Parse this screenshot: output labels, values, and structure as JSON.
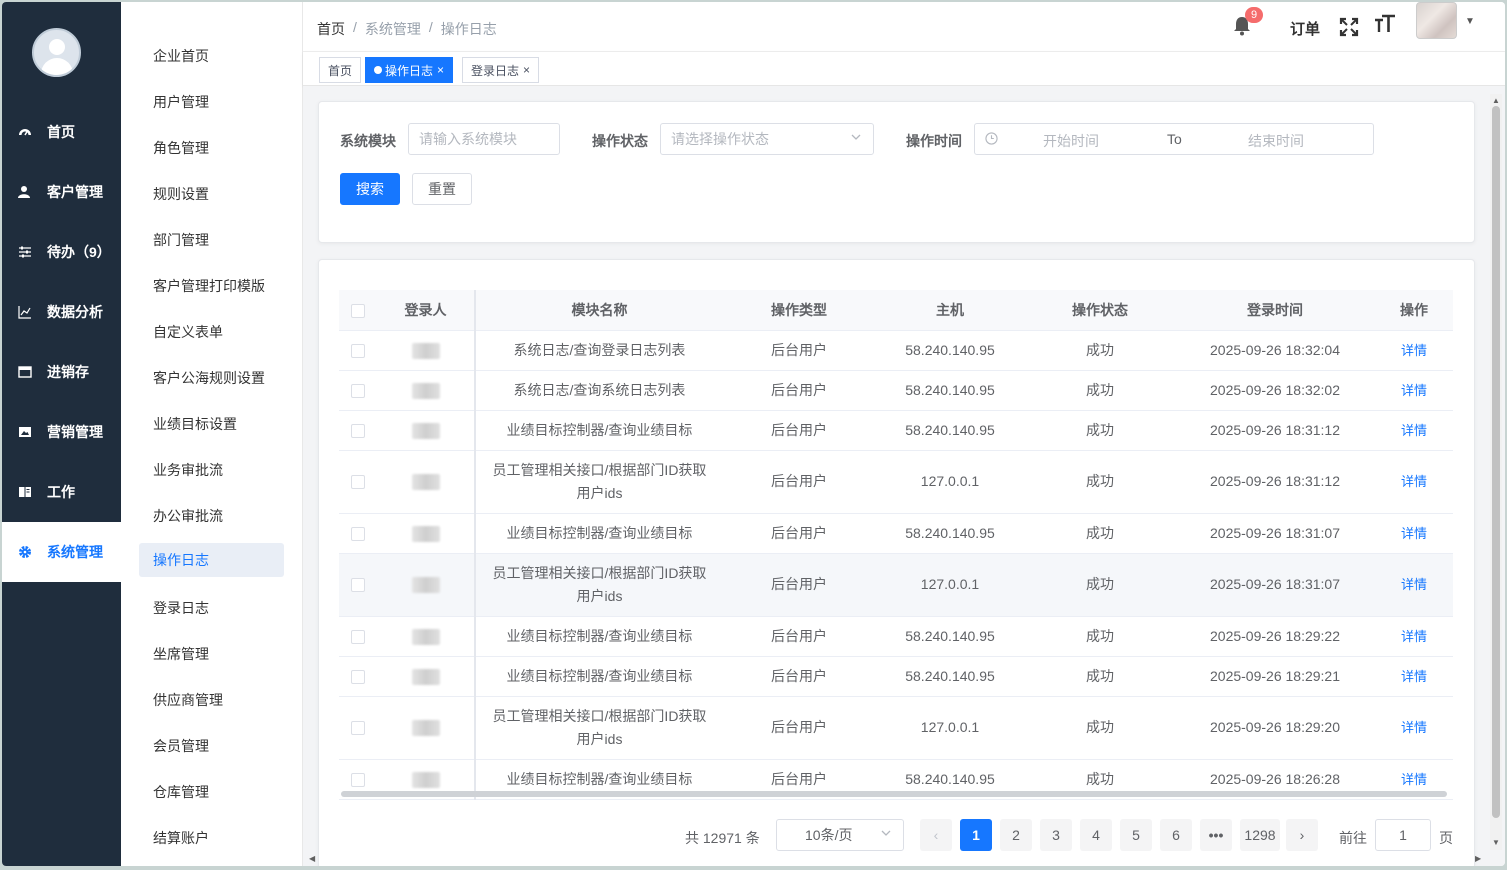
{
  "sidebar": {
    "items": [
      {
        "label": "首页",
        "icon": "dashboard-icon"
      },
      {
        "label": "客户管理",
        "icon": "user-icon"
      },
      {
        "label": "待办（9）",
        "icon": "sliders-icon"
      },
      {
        "label": "数据分析",
        "icon": "line-chart-icon"
      },
      {
        "label": "进销存",
        "icon": "window-icon"
      },
      {
        "label": "营销管理",
        "icon": "image-icon"
      },
      {
        "label": "工作",
        "icon": "book-icon"
      },
      {
        "label": "系统管理",
        "icon": "gear-icon"
      }
    ]
  },
  "submenu": {
    "items": [
      "企业首页",
      "用户管理",
      "角色管理",
      "规则设置",
      "部门管理",
      "客户管理打印模版",
      "自定义表单",
      "客户公海规则设置",
      "业绩目标设置",
      "业务审批流",
      "办公审批流",
      "操作日志",
      "登录日志",
      "坐席管理",
      "供应商管理",
      "会员管理",
      "仓库管理",
      "结算账户"
    ]
  },
  "header": {
    "breadcrumb": [
      "首页",
      "系统管理",
      "操作日志"
    ],
    "breadcrumb_sep": "/",
    "notification_count": "9",
    "order_label": "订单",
    "font_icon": "тT"
  },
  "tabs": [
    {
      "label": "首页"
    },
    {
      "label": "操作日志"
    },
    {
      "label": "登录日志"
    }
  ],
  "tab_close": "×",
  "search": {
    "module_label": "系统模块",
    "module_placeholder": "请输入系统模块",
    "status_label": "操作状态",
    "status_placeholder": "请选择操作状态",
    "time_label": "操作时间",
    "start_placeholder": "开始时间",
    "to_label": "To",
    "end_placeholder": "结束时间",
    "search_button": "搜索",
    "reset_button": "重置"
  },
  "table": {
    "columns": [
      "登录人",
      "模块名称",
      "操作类型",
      "主机",
      "操作状态",
      "登录时间",
      "操作"
    ],
    "rows": [
      {
        "module": "系统日志/查询登录日志列表",
        "type": "后台用户",
        "host": "58.240.140.95",
        "status": "成功",
        "time": "2025-09-26 18:32:04",
        "action": "详情"
      },
      {
        "module": "系统日志/查询系统日志列表",
        "type": "后台用户",
        "host": "58.240.140.95",
        "status": "成功",
        "time": "2025-09-26 18:32:02",
        "action": "详情"
      },
      {
        "module": "业绩目标控制器/查询业绩目标",
        "type": "后台用户",
        "host": "58.240.140.95",
        "status": "成功",
        "time": "2025-09-26 18:31:12",
        "action": "详情"
      },
      {
        "module": "员工管理相关接口/根据部门ID获取用户ids",
        "type": "后台用户",
        "host": "127.0.0.1",
        "status": "成功",
        "time": "2025-09-26 18:31:12",
        "action": "详情"
      },
      {
        "module": "业绩目标控制器/查询业绩目标",
        "type": "后台用户",
        "host": "58.240.140.95",
        "status": "成功",
        "time": "2025-09-26 18:31:07",
        "action": "详情"
      },
      {
        "module": "员工管理相关接口/根据部门ID获取用户ids",
        "type": "后台用户",
        "host": "127.0.0.1",
        "status": "成功",
        "time": "2025-09-26 18:31:07",
        "action": "详情"
      },
      {
        "module": "业绩目标控制器/查询业绩目标",
        "type": "后台用户",
        "host": "58.240.140.95",
        "status": "成功",
        "time": "2025-09-26 18:29:22",
        "action": "详情"
      },
      {
        "module": "业绩目标控制器/查询业绩目标",
        "type": "后台用户",
        "host": "58.240.140.95",
        "status": "成功",
        "time": "2025-09-26 18:29:21",
        "action": "详情"
      },
      {
        "module": "员工管理相关接口/根据部门ID获取用户ids",
        "type": "后台用户",
        "host": "127.0.0.1",
        "status": "成功",
        "time": "2025-09-26 18:29:20",
        "action": "详情"
      },
      {
        "module": "业绩目标控制器/查询业绩目标",
        "type": "后台用户",
        "host": "58.240.140.95",
        "status": "成功",
        "time": "2025-09-26 18:26:28",
        "action": "详情"
      }
    ]
  },
  "pagination": {
    "total_text": "共 12971 条",
    "page_size": "10条/页",
    "pages": [
      "1",
      "2",
      "3",
      "4",
      "5",
      "6",
      "•••",
      "1298"
    ],
    "prev": "‹",
    "next": "›",
    "goto_label": "前往",
    "goto_value": "1",
    "page_unit": "页"
  },
  "colors": {
    "primary": "#1677ff",
    "sidebar_bg": "#1f2d3d",
    "badge": "#f56c6c"
  }
}
